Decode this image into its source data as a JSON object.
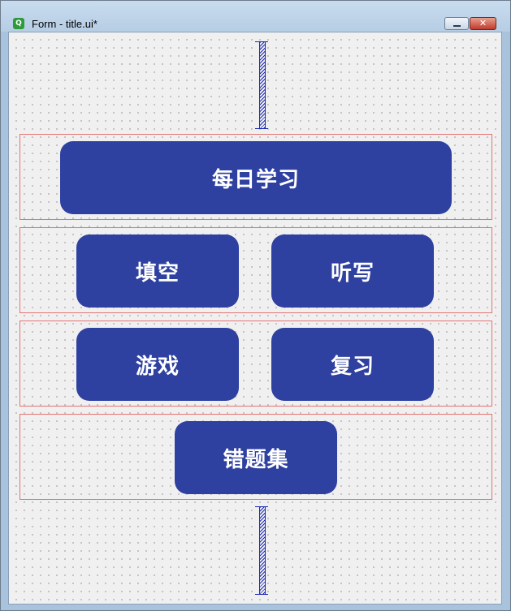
{
  "window": {
    "title": "Form - title.ui*",
    "app_icon": "qt-designer-icon",
    "close_label": "✕"
  },
  "form": {
    "rows": [
      {
        "buttons": [
          {
            "label": "每日学习"
          }
        ]
      },
      {
        "buttons": [
          {
            "label": "填空"
          },
          {
            "label": "听写"
          }
        ]
      },
      {
        "buttons": [
          {
            "label": "游戏"
          },
          {
            "label": "复习"
          }
        ]
      },
      {
        "buttons": [
          {
            "label": "错题集"
          }
        ]
      }
    ]
  },
  "colors": {
    "button_bg": "#2e40a0",
    "button_text": "#ffffff",
    "layout_border": "#e57373",
    "spacer": "#1b2ab4"
  }
}
